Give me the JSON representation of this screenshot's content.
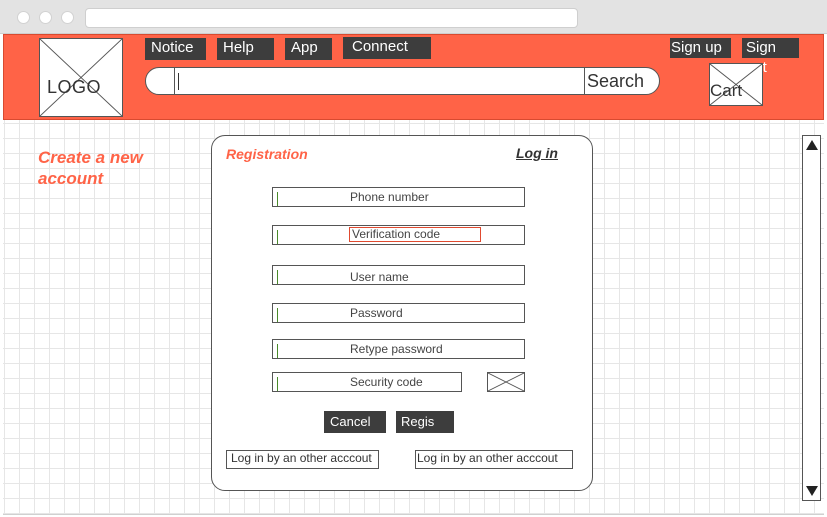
{
  "header": {
    "logo_label": "LOGO",
    "nav": [
      "Notice",
      "Help",
      "App",
      "Connect"
    ],
    "search": {
      "value": "",
      "button_label": "Search"
    },
    "auth": {
      "signup": "Sign up",
      "signout": "Sign out"
    },
    "cart_label": "Cart"
  },
  "page": {
    "heading": "Create a new account"
  },
  "form": {
    "title": "Registration",
    "login_link": "Log in",
    "fields": {
      "phone": "Phone number",
      "verification": "Verification code",
      "username": "User name",
      "password": "Password",
      "retype": "Retype password",
      "security": "Security code"
    },
    "cancel_label": "Cancel",
    "register_label": "Regis",
    "alt_login_1": "Log in by an other acccout",
    "alt_login_2": "Log in by an other acccout"
  },
  "colors": {
    "accent": "#ff6347",
    "dark_button": "#3d3d3d"
  }
}
